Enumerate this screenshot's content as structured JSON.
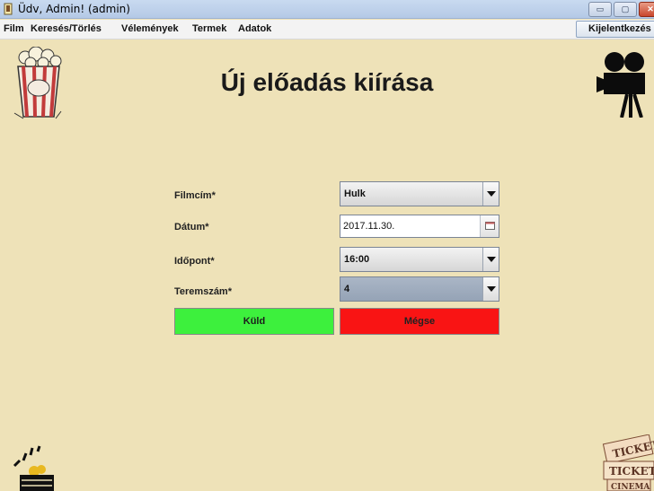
{
  "window": {
    "title": "Üdv, Admin! (admin)",
    "minimize_icon": "▭",
    "maximize_icon": "▢",
    "close_icon": "✕"
  },
  "menu": {
    "items": [
      "Film",
      "Keresés/Törlés",
      "Vélemények",
      "Termek",
      "Adatok"
    ],
    "logout_label": "Kijelentkezés"
  },
  "page": {
    "title": "Új előadás kiírása"
  },
  "form": {
    "film_label": "Filmcím*",
    "film_value": "Hulk",
    "date_label": "Dátum*",
    "date_value": "2017.11.30.",
    "time_label": "Időpont*",
    "time_value": "16:00",
    "room_label": "Teremszám*",
    "room_value": "4",
    "submit_label": "Küld",
    "cancel_label": "Mégse"
  },
  "colors": {
    "background": "#eee2b8",
    "submit": "#3df03d",
    "cancel": "#f91414"
  },
  "icons": {
    "popcorn": "popcorn-icon",
    "camera": "movie-camera-icon",
    "clapper": "clapperboard-icon",
    "ticket": "cinema-ticket-icon",
    "calendar": "calendar-icon"
  }
}
